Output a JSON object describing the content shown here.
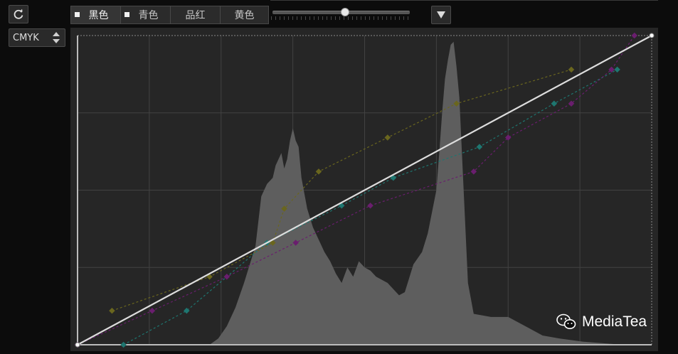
{
  "reset_button": {
    "icon": "refresh-icon"
  },
  "color_mode": {
    "selected": "CMYK",
    "icon": "up-down-arrows-icon"
  },
  "channel_tabs": [
    {
      "label": "黑色",
      "active": true,
      "checked": true
    },
    {
      "label": "青色",
      "active": false,
      "checked": true
    },
    {
      "label": "品红",
      "active": false,
      "checked": false
    },
    {
      "label": "黄色",
      "active": false,
      "checked": false
    }
  ],
  "slider": {
    "level": 0.53
  },
  "dropdown_button": {
    "icon": "triangle-down-icon"
  },
  "graph": {
    "colors": {
      "background": "#262626",
      "grid": "#424242",
      "histogram": "#5e5e5e",
      "black_curve": "#dddddd",
      "cyan_curve": "#1e7670",
      "magenta_curve": "#6a1e6e",
      "yellow_curve": "#6a661e"
    },
    "curves": {
      "black": [
        [
          0,
          0
        ],
        [
          1,
          1
        ]
      ],
      "cyan": [
        [
          0.08,
          0.0
        ],
        [
          0.19,
          0.11
        ],
        [
          0.33,
          0.33
        ],
        [
          0.46,
          0.45
        ],
        [
          0.55,
          0.54
        ],
        [
          0.7,
          0.64
        ],
        [
          0.83,
          0.78
        ],
        [
          0.94,
          0.89
        ]
      ],
      "magenta": [
        [
          0.0,
          0.0
        ],
        [
          0.13,
          0.11
        ],
        [
          0.26,
          0.22
        ],
        [
          0.38,
          0.33
        ],
        [
          0.51,
          0.45
        ],
        [
          0.69,
          0.56
        ],
        [
          0.75,
          0.67
        ],
        [
          0.86,
          0.78
        ],
        [
          0.93,
          0.89
        ],
        [
          0.97,
          1.0
        ]
      ],
      "yellow": [
        [
          0.06,
          0.11
        ],
        [
          0.23,
          0.22
        ],
        [
          0.34,
          0.33
        ],
        [
          0.36,
          0.44
        ],
        [
          0.42,
          0.56
        ],
        [
          0.54,
          0.67
        ],
        [
          0.66,
          0.78
        ],
        [
          0.86,
          0.89
        ]
      ]
    }
  },
  "watermark": {
    "text": "MediaTea",
    "icon": "wechat-icon"
  }
}
